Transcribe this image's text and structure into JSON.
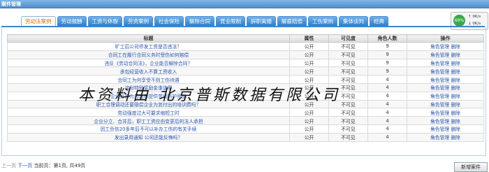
{
  "window": {
    "title": "案件管理"
  },
  "tabs": [
    "劳动法案例",
    "劳动报酬",
    "工资与休假",
    "劳资案例",
    "社会保险",
    "解除合同",
    "竞业限制",
    "辞职离婚",
    "解雇赔偿",
    "工伤案例",
    "集体谈判",
    "经典"
  ],
  "monitor": {
    "percent": "69%",
    "up": "0K/s",
    "down": "0K/s"
  },
  "table": {
    "headers": [
      "标题",
      "属性",
      "可见度",
      "角色人数",
      "操作"
    ],
    "rows": [
      [
        "旷工后公司停发工资是否违法？",
        "公开",
        "不可见",
        "9",
        "角色管理 删除"
      ],
      [
        "合同工在履行合同义务时受伤如何赔偿",
        "公开",
        "不可见",
        "9",
        "角色管理 删除"
      ],
      [
        "违反《劳动合同法》，企业能否解除合同？",
        "公开",
        "不可见",
        "9",
        "角色管理 删除"
      ],
      [
        "承包经营收入不算工资收入",
        "公开",
        "不可见",
        "9",
        "角色管理 删除"
      ],
      [
        "合同工为何享受不到工伤待遇",
        "公开",
        "不可见",
        "4",
        "角色管理 删除"
      ],
      [
        "这份特别奖励金谁该得",
        "公开",
        "不可见",
        "4",
        "角色管理 删除"
      ],
      [
        "企业必须为劳动者提供劳动防护用品",
        "公开",
        "不可见",
        "4",
        "角色管理 删除"
      ],
      [
        "职工合理调动还要赔偿企业为其付出的培训费吗？",
        "公开",
        "不可见",
        "4",
        "角色管理 删除"
      ],
      [
        "劳动强度过大可要求缩短工时",
        "公开",
        "不可见",
        "4",
        "角色管理 删除"
      ],
      [
        "企业分立、合并后，职工工资应由变更后的法人承担",
        "公开",
        "不可见",
        "4",
        "角色管理 删除"
      ],
      [
        "因工负伤20多年后不可以补办工伤的有关手续",
        "公开",
        "不可见",
        "4",
        "角色管理 删除"
      ],
      [
        "发出录用通知 公司还能反悔吗？",
        "公开",
        "不可见",
        "4",
        "角色管理 删除"
      ]
    ]
  },
  "watermark": "本资料由 北京普斯数据有限公司",
  "pager": {
    "prev": "上一页",
    "next": "下一页",
    "info": "当前页：第1页, 共49页"
  },
  "new_button": "新增案件"
}
